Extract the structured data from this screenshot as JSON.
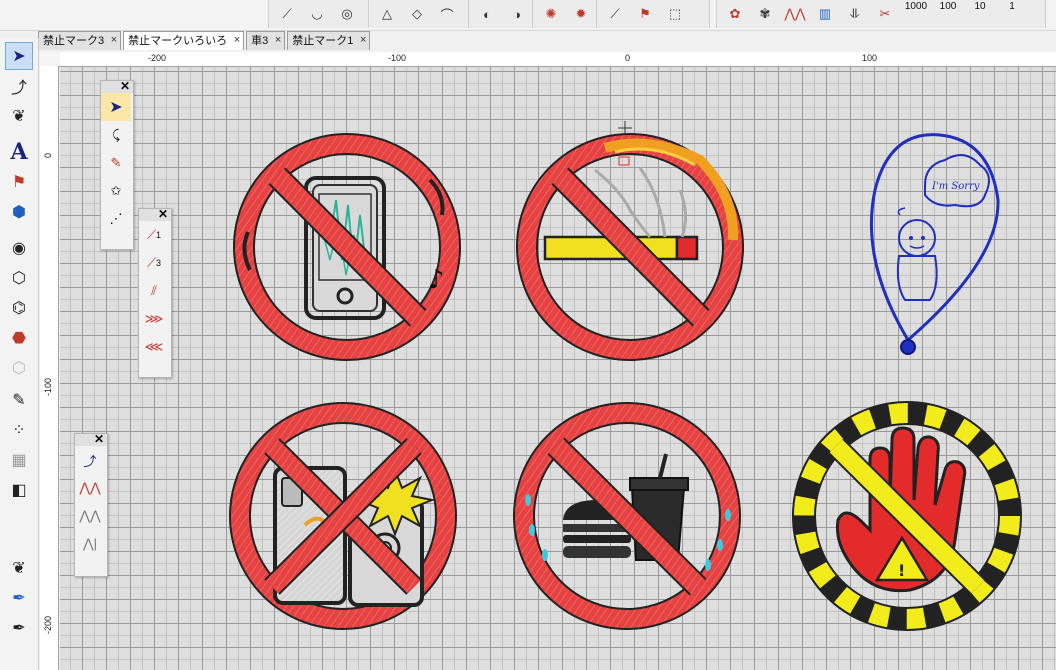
{
  "tabs": [
    {
      "label": "禁止マーク3",
      "active": false
    },
    {
      "label": "禁止マークいろいろ",
      "active": true
    },
    {
      "label": "車3",
      "active": false
    },
    {
      "label": "禁止マーク1",
      "active": false
    }
  ],
  "tab_close_glyph": "×",
  "toolbar": {
    "numbers": [
      "1000",
      "100",
      "10",
      "1"
    ]
  },
  "ruler": {
    "top_labels": [
      "-200",
      "-100",
      "0",
      "100"
    ],
    "left_labels": [
      "0",
      "-100",
      "-200"
    ]
  },
  "palettes": {
    "close_glyph": "✕",
    "stitch_counts": [
      "1",
      "3"
    ]
  },
  "canvas": {
    "bubble_text": "I'm Sorry"
  },
  "colors": {
    "sign_red": "#e32b2b",
    "sign_dark": "#2a2a2a",
    "blue_design": "#1f2fbf",
    "hazard_yellow": "#f2ec1c"
  }
}
